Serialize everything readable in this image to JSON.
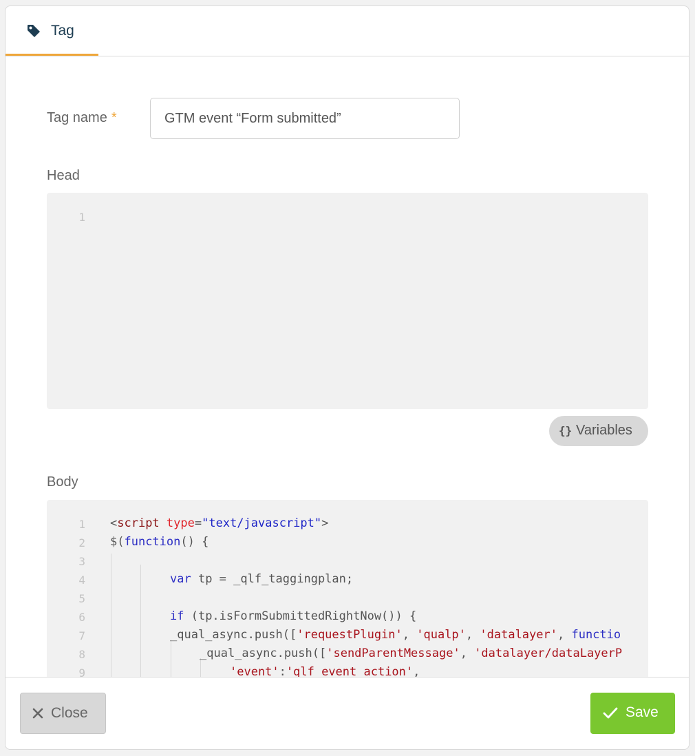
{
  "tab": {
    "label": "Tag",
    "icon": "tag-icon"
  },
  "form": {
    "tag_name_label": "Tag name",
    "required_marker": "*",
    "tag_name_value": "GTM event “Form submitted”",
    "head_label": "Head",
    "body_label": "Body",
    "variables_label": "Variables"
  },
  "head_editor": {
    "line_numbers": [
      "1"
    ],
    "lines": [
      ""
    ]
  },
  "body_editor": {
    "line_numbers": [
      "1",
      "2",
      "3",
      "4",
      "5",
      "6",
      "7",
      "8",
      "9"
    ],
    "lines": [
      [
        {
          "t": "<",
          "c": "id"
        },
        {
          "t": "script",
          "c": "tag"
        },
        {
          "t": " ",
          "c": "id"
        },
        {
          "t": "type",
          "c": "attr"
        },
        {
          "t": "=",
          "c": "id"
        },
        {
          "t": "\"text/javascript\"",
          "c": "str"
        },
        {
          "t": ">",
          "c": "id"
        }
      ],
      [
        {
          "t": "$(",
          "c": "id"
        },
        {
          "t": "function",
          "c": "kw"
        },
        {
          "t": "() {",
          "c": "id"
        }
      ],
      [],
      [
        {
          "t": "var",
          "c": "kw"
        },
        {
          "t": " tp = _qlf_taggingplan;",
          "c": "id"
        }
      ],
      [],
      [
        {
          "t": "if",
          "c": "kw"
        },
        {
          "t": " (tp.isFormSubmittedRightNow()) {",
          "c": "id"
        }
      ],
      [
        {
          "t": "_qual_async.push([",
          "c": "id"
        },
        {
          "t": "'requestPlugin'",
          "c": "s"
        },
        {
          "t": ", ",
          "c": "id"
        },
        {
          "t": "'qualp'",
          "c": "s"
        },
        {
          "t": ", ",
          "c": "id"
        },
        {
          "t": "'datalayer'",
          "c": "s"
        },
        {
          "t": ", ",
          "c": "id"
        },
        {
          "t": "functio",
          "c": "kw"
        }
      ],
      [
        {
          "t": "_qual_async.push([",
          "c": "id"
        },
        {
          "t": "'sendParentMessage'",
          "c": "s"
        },
        {
          "t": ", ",
          "c": "id"
        },
        {
          "t": "'datalayer/dataLayerP",
          "c": "s"
        }
      ],
      [
        {
          "t": "'event'",
          "c": "s"
        },
        {
          "t": ":",
          "c": "id"
        },
        {
          "t": "'qlf_event_action'",
          "c": "s"
        },
        {
          "t": ",",
          "c": "id"
        }
      ]
    ]
  },
  "footer": {
    "close_label": "Close",
    "save_label": "Save"
  },
  "colors": {
    "accent": "#efa63a",
    "save": "#7ac72f",
    "tab_text": "#1d3d52"
  }
}
